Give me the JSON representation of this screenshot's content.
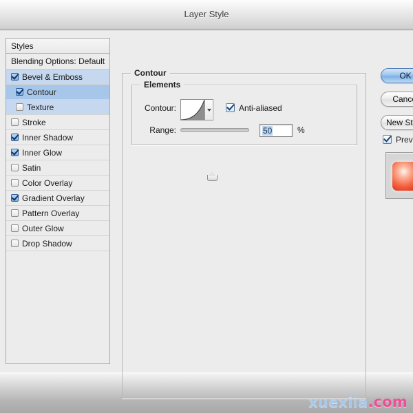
{
  "window": {
    "title": "Layer Style"
  },
  "styles_panel": {
    "header": "Styles",
    "blending_options": "Blending Options: Default",
    "effects": [
      {
        "label": "Bevel & Emboss",
        "checked": true,
        "indent": false,
        "state": "parent-selected"
      },
      {
        "label": "Contour",
        "checked": true,
        "indent": true,
        "state": "selected"
      },
      {
        "label": "Texture",
        "checked": false,
        "indent": true,
        "state": "parent-selected"
      },
      {
        "label": "Stroke",
        "checked": false,
        "indent": false,
        "state": "normal"
      },
      {
        "label": "Inner Shadow",
        "checked": true,
        "indent": false,
        "state": "normal"
      },
      {
        "label": "Inner Glow",
        "checked": true,
        "indent": false,
        "state": "normal"
      },
      {
        "label": "Satin",
        "checked": false,
        "indent": false,
        "state": "normal"
      },
      {
        "label": "Color Overlay",
        "checked": false,
        "indent": false,
        "state": "normal"
      },
      {
        "label": "Gradient Overlay",
        "checked": true,
        "indent": false,
        "state": "normal"
      },
      {
        "label": "Pattern Overlay",
        "checked": false,
        "indent": false,
        "state": "normal"
      },
      {
        "label": "Outer Glow",
        "checked": false,
        "indent": false,
        "state": "normal"
      },
      {
        "label": "Drop Shadow",
        "checked": false,
        "indent": false,
        "state": "normal"
      }
    ]
  },
  "contour_panel": {
    "group_label": "Contour",
    "elements_label": "Elements",
    "contour_field_label": "Contour:",
    "contour_swatch_icon": "contour-curve-swatch",
    "dropdown_icon": "chevron-down-icon",
    "anti_aliased_label": "Anti-aliased",
    "anti_aliased_checked": true,
    "range_label": "Range:",
    "range_value": "50",
    "range_unit": "%",
    "range_slider_position_percent": 45
  },
  "buttons": {
    "ok": "OK",
    "cancel": "Cancel",
    "new_style": "New Style...",
    "preview_label": "Preview",
    "preview_checked": true,
    "preview_thumb_icon": "layer-preview-thumbnail"
  },
  "watermark": {
    "name": "xuexila",
    "tld": ".com"
  },
  "colors": {
    "window_bg": "#ececec",
    "selection": "#a7c7ea",
    "selection_parent": "#c6d8ef",
    "default_button": "#7eb0e4",
    "watermark_name": "#a9c9e8",
    "watermark_tld": "#ef4f96"
  }
}
